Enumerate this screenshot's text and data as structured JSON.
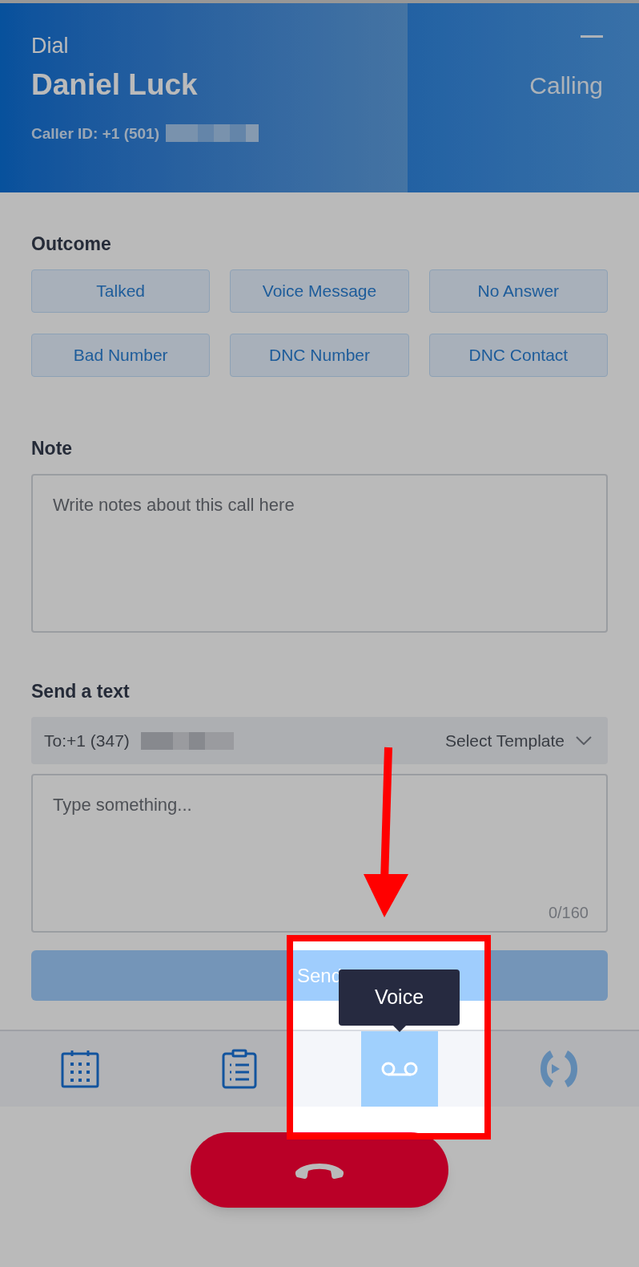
{
  "header": {
    "label": "Dial",
    "contact_name": "Daniel Luck",
    "caller_id": "Caller ID: +1 (501)",
    "status": "Calling"
  },
  "outcome": {
    "title": "Outcome",
    "options": [
      {
        "label": "Talked",
        "selected": false
      },
      {
        "label": "Voice Message",
        "selected": false
      },
      {
        "label": "No Answer",
        "selected": false
      },
      {
        "label": "Bad Number",
        "selected": false
      },
      {
        "label": "DNC Number",
        "selected": false
      },
      {
        "label": "DNC Contact",
        "selected": false
      }
    ]
  },
  "note": {
    "title": "Note",
    "placeholder": "Write notes about this call here"
  },
  "send_text": {
    "title": "Send a text",
    "to": "To:+1 (347)",
    "template": "Select Template",
    "placeholder": "Type something...",
    "counter": "0/160",
    "button": "Send"
  },
  "tabs": [
    {
      "kind": "calendar",
      "selected": false
    },
    {
      "kind": "notes",
      "selected": false
    },
    {
      "kind": "voicemail",
      "selected": true
    },
    {
      "kind": "transfer",
      "selected": false
    }
  ],
  "tooltip": "Voice"
}
